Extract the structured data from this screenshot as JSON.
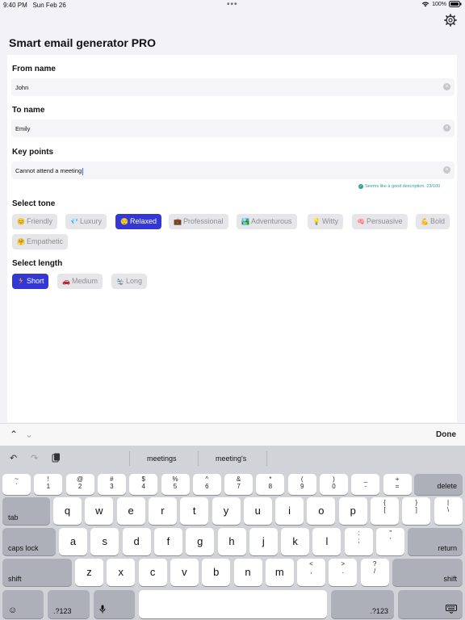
{
  "status": {
    "time": "9:40 PM",
    "date": "Sun Feb 26",
    "battery": "100%"
  },
  "app": {
    "title": "Smart email generator PRO"
  },
  "form": {
    "from_label": "From name",
    "from_value": "John",
    "to_label": "To name",
    "to_value": "Emily",
    "key_label": "Key points",
    "key_value": "Cannot attend a meeting",
    "hint": "Seems like a good description. 23/100",
    "tone_label": "Select tone",
    "tones": [
      {
        "emoji": "😊",
        "label": "Friendly"
      },
      {
        "emoji": "💎",
        "label": "Luxury"
      },
      {
        "emoji": "😌",
        "label": "Relaxed"
      },
      {
        "emoji": "💼",
        "label": "Professional"
      },
      {
        "emoji": "🏞️",
        "label": "Adventurous"
      },
      {
        "emoji": "💡",
        "label": "Witty"
      },
      {
        "emoji": "🧠",
        "label": "Persuasive"
      },
      {
        "emoji": "💪",
        "label": "Bold"
      },
      {
        "emoji": "🤗",
        "label": "Empathetic"
      }
    ],
    "selected_tone": "Relaxed",
    "length_label": "Select length",
    "lengths": [
      {
        "emoji": "🏃",
        "label": "Short"
      },
      {
        "emoji": "🚗",
        "label": "Medium"
      },
      {
        "emoji": "🛬",
        "label": "Long"
      }
    ],
    "selected_length": "Short"
  },
  "accessory": {
    "done": "Done"
  },
  "keyboard": {
    "suggestions": [
      "meetings",
      "meeting's"
    ],
    "num_row": [
      {
        "top": "~",
        "bot": "`"
      },
      {
        "top": "!",
        "bot": "1"
      },
      {
        "top": "@",
        "bot": "2"
      },
      {
        "top": "#",
        "bot": "3"
      },
      {
        "top": "$",
        "bot": "4"
      },
      {
        "top": "%",
        "bot": "5"
      },
      {
        "top": "^",
        "bot": "6"
      },
      {
        "top": "&",
        "bot": "7"
      },
      {
        "top": "*",
        "bot": "8"
      },
      {
        "top": "(",
        "bot": "9"
      },
      {
        "top": ")",
        "bot": "0"
      },
      {
        "top": "_",
        "bot": "-"
      },
      {
        "top": "+",
        "bot": "="
      }
    ],
    "delete": "delete",
    "tab": "tab",
    "row1": [
      "q",
      "w",
      "e",
      "r",
      "t",
      "y",
      "u",
      "i",
      "o",
      "p"
    ],
    "row1_sym": [
      {
        "top": "{",
        "bot": "["
      },
      {
        "top": "}",
        "bot": "]"
      },
      {
        "top": "|",
        "bot": "\\"
      }
    ],
    "caps": "caps lock",
    "row2": [
      "a",
      "s",
      "d",
      "f",
      "g",
      "h",
      "j",
      "k",
      "l"
    ],
    "row2_sym": [
      {
        "top": ":",
        "bot": ";"
      },
      {
        "top": "\"",
        "bot": "'"
      }
    ],
    "return": "return",
    "shift": "shift",
    "row3": [
      "z",
      "x",
      "c",
      "v",
      "b",
      "n",
      "m"
    ],
    "row3_sym": [
      {
        "top": "<",
        "bot": ","
      },
      {
        "top": ">",
        "bot": "."
      },
      {
        "top": "?",
        "bot": "/"
      }
    ],
    "num_toggle": ".?123"
  }
}
